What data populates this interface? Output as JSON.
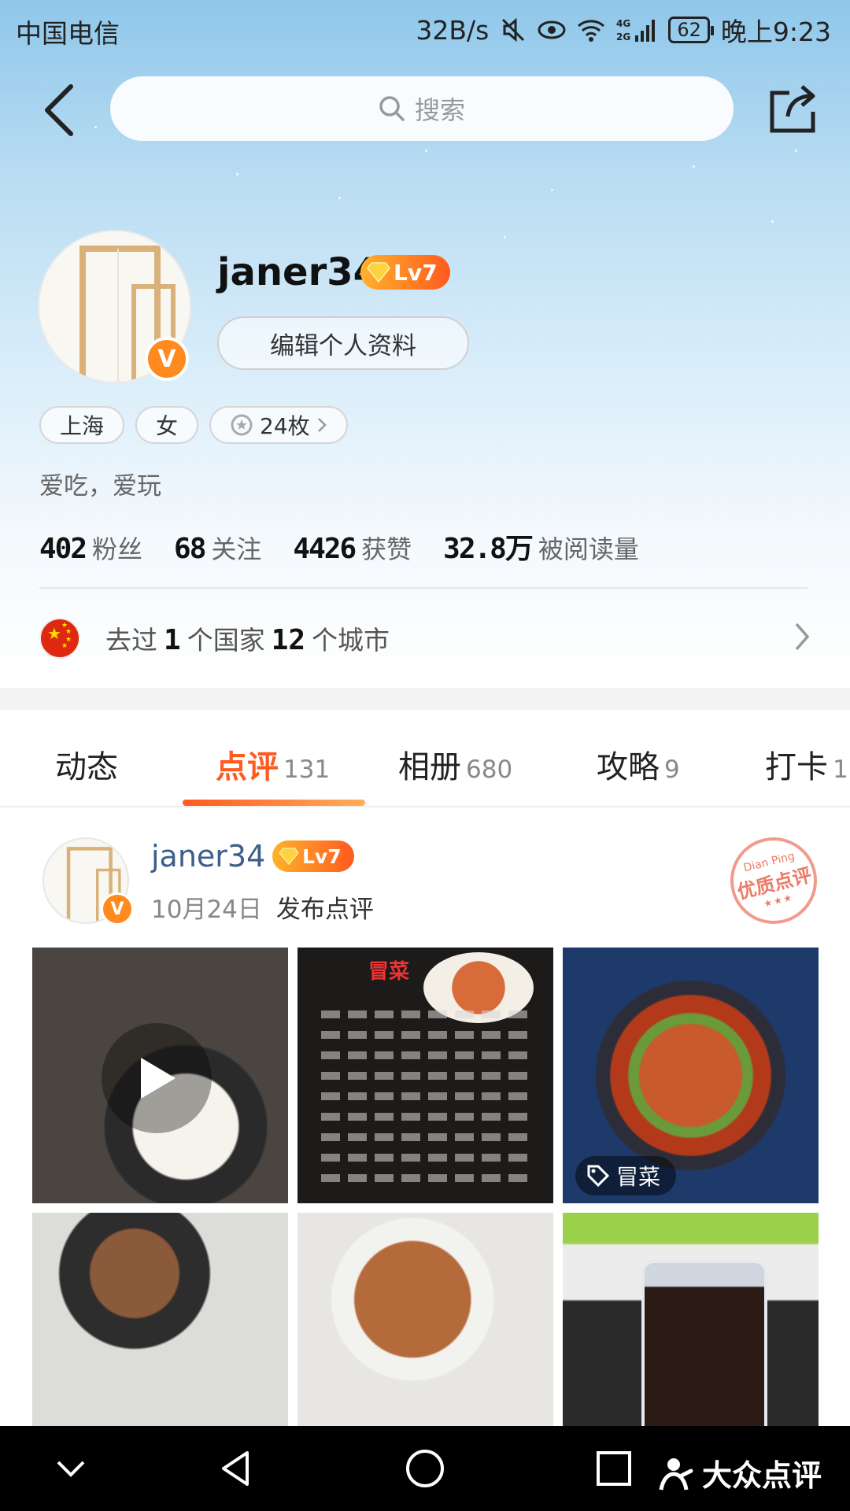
{
  "status_bar": {
    "carrier": "中国电信",
    "net_speed": "32B/s",
    "network": "4G 2G",
    "battery": "62",
    "time": "晚上9:23"
  },
  "top_bar": {
    "search_placeholder": "搜索",
    "back_icon": "chevron-left-icon",
    "share_icon": "share-icon"
  },
  "profile": {
    "username": "janer34",
    "level": "Lv7",
    "verified_badge": "V",
    "edit_label": "编辑个人资料",
    "tags": {
      "city": "上海",
      "gender": "女",
      "medals": "24枚"
    },
    "bio": "爱吃，爱玩",
    "stats": {
      "fans": {
        "value": "402",
        "label": "粉丝"
      },
      "following": {
        "value": "68",
        "label": "关注"
      },
      "likes": {
        "value": "4426",
        "label": "获赞"
      },
      "reads": {
        "value": "32.8万",
        "label": "被阅读量"
      }
    },
    "travel": {
      "prefix": "去过",
      "countries": "1",
      "countries_unit": "个国家",
      "cities": "12",
      "cities_unit": "个城市"
    }
  },
  "tabs": [
    {
      "label": "动态",
      "count": ""
    },
    {
      "label": "点评",
      "count": "131"
    },
    {
      "label": "相册",
      "count": "680"
    },
    {
      "label": "攻略",
      "count": "9"
    },
    {
      "label": "打卡",
      "count": "1"
    }
  ],
  "active_tab": "点评",
  "post": {
    "username": "janer34",
    "level": "Lv7",
    "date": "10月24日",
    "action": "发布点评",
    "stamp": {
      "top": "Dian Ping",
      "main": "优质点评",
      "stars": "★★★"
    },
    "menu_title": "冒菜",
    "food_tag": "冒菜"
  },
  "bottom_nav": {
    "brand": "大众点评"
  },
  "colors": {
    "accent": "#ff5a1f",
    "level_badge": "#ff8a1e",
    "link_name": "#3b5e8c"
  }
}
